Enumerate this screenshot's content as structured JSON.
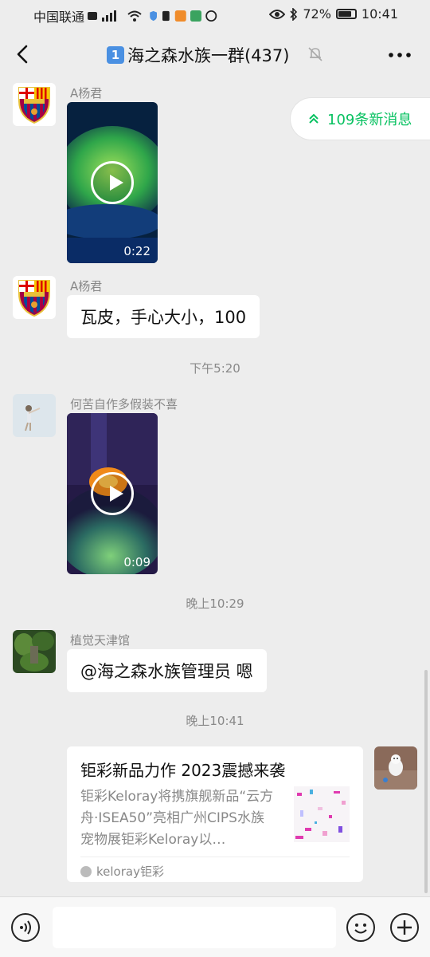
{
  "status_bar": {
    "carrier": "中国联通",
    "battery": "72%",
    "battery_level": 0.72,
    "time": "10:41"
  },
  "header": {
    "badge": "1",
    "title": "海之森水族一群(437)",
    "back_icon": "chevron-left-icon",
    "mute_icon": "bell-off-icon",
    "more_icon": "more-icon"
  },
  "new_messages": {
    "label": "109条新消息",
    "icon": "double-chevron-up-icon",
    "color": "#07c160"
  },
  "messages": [
    {
      "type": "video",
      "sender": "A杨君",
      "duration": "0:22"
    },
    {
      "type": "text",
      "sender": "A杨君",
      "text": "瓦皮，手心大小，100"
    },
    {
      "type": "time",
      "text": "下午5:20"
    },
    {
      "type": "video",
      "sender": "何苦自作多假装不喜",
      "duration": "0:09"
    },
    {
      "type": "time",
      "text": "晚上10:29"
    },
    {
      "type": "text",
      "sender": "植觉天津馆",
      "text": "@海之森水族管理员   嗯"
    },
    {
      "type": "time",
      "text": "晚上10:41"
    },
    {
      "type": "link_card",
      "title": "钜彩新品力作 2023震撼来袭",
      "desc": "钜彩Keloray将携旗舰新品“云方舟·ISEA50”亮相广州CIPS水族宠物展钜彩Keloray以…",
      "source": "keloray钜彩"
    }
  ],
  "input_bar": {
    "voice_icon": "voice-icon",
    "emoji_icon": "emoji-icon",
    "plus_icon": "plus-icon",
    "text_value": ""
  }
}
